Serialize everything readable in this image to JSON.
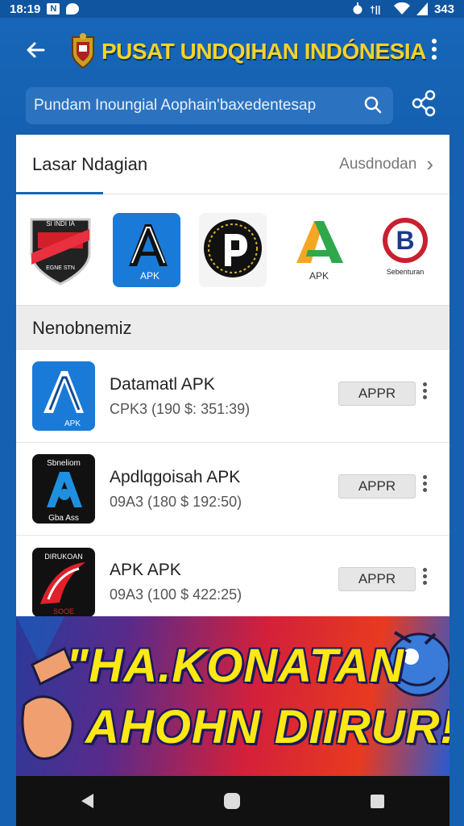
{
  "status_bar": {
    "time": "18:19",
    "battery": "343"
  },
  "app_bar": {
    "title": "PUSAT UNDQIHAN INDÓNESIA",
    "search_placeholder": "Pundam Inoungial Aophain'baxedentesap"
  },
  "section_featured": {
    "title": "Lasar Ndagian",
    "more_label": "Ausdnodan",
    "apps": [
      {
        "name": "app-tile-1",
        "label": ""
      },
      {
        "name": "app-tile-2",
        "label": "APK"
      },
      {
        "name": "app-tile-3",
        "label": ""
      },
      {
        "name": "app-tile-4",
        "label": "APK"
      },
      {
        "name": "app-tile-5",
        "label": "Sebenturan"
      }
    ]
  },
  "section_list": {
    "title": "Nenobnemiz",
    "items": [
      {
        "name": "Datamatl APK",
        "meta": "CPK3 (190 $: 351:39)",
        "button": "APPR",
        "icon_label": "APK"
      },
      {
        "name": "Apdlqgoisah APK",
        "meta": "09A3 (180 $ 192:50)",
        "button": "APPR",
        "icon_top": "Sbneliom",
        "icon_bottom": "Gba Ass"
      },
      {
        "name": "APK APK",
        "meta": "09A3 (100 $ 422:25)",
        "button": "APPR",
        "icon_top": "DIRUKOAN",
        "icon_bottom": "SOOE"
      }
    ]
  },
  "banner": {
    "line1": "\"HA.KONATAN",
    "line2": "AHOHN DIIRUR!"
  },
  "colors": {
    "primary": "#1560b0",
    "title_yellow": "#f5d327",
    "banner_text": "#ffe814"
  }
}
